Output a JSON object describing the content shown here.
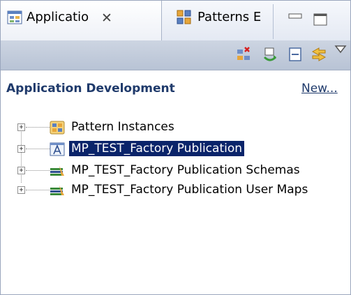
{
  "tabs": [
    {
      "label": "Applicatio",
      "icon": "application-development-icon",
      "active": true
    },
    {
      "label": "Patterns E",
      "icon": "patterns-explorer-icon",
      "active": false
    }
  ],
  "toolbar": {
    "icons": [
      "new-pattern-icon",
      "refresh-icon",
      "collapse-all-icon",
      "link-with-editor-icon",
      "view-menu-icon"
    ]
  },
  "section": {
    "title": "Application Development",
    "new_link": "New..."
  },
  "tree": {
    "items": [
      {
        "label": "Pattern Instances",
        "icon": "pattern-instances-icon",
        "selected": false
      },
      {
        "label": "MP_TEST_Factory Publication",
        "icon": "application-icon",
        "selected": true
      },
      {
        "label": "MP_TEST_Factory Publication Schemas",
        "icon": "library-icon",
        "selected": false
      },
      {
        "label": "MP_TEST_Factory Publication User Maps",
        "icon": "library-icon",
        "selected": false
      }
    ]
  },
  "colors": {
    "selection": "#0a246a",
    "link": "#1f3a6b",
    "toolbar": "#c4cddc"
  }
}
